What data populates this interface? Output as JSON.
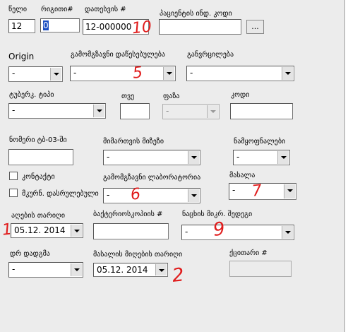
{
  "labels": {
    "year": "წელი",
    "row_no": "რიგითი#",
    "registry_no": "დათესვის #",
    "patient_code": "პაციენტის ინდ. კოდი",
    "origin": "Origin",
    "detected_institution": "გამომგზავნი დაწესებულება",
    "diagnosis": "განვრცილება",
    "tb_type": "ტუბერკ. ტიპი",
    "month": "თვე",
    "phase": "ფაზა",
    "code": "კოდი",
    "form_no": "ნომერი ტბ-03-ში",
    "referral_reason": "მიმართვის მიზეზი",
    "diagnosis_codes": "ნამყოფნალები",
    "contact": "კონტაქტი",
    "monitoring": "მკურნ. დასრულებული",
    "sending_laboratory": "გამომგზავნი ლაბორატორია",
    "material": "მასალა",
    "taken_date": "აღების თარიღი",
    "bacterio_no": "ბაქტერიოსკოპიის #",
    "smear_result": "ნაცხის მიკრ. შედეგი",
    "doctor": "დრ დადგმა",
    "material_received_date": "მასალის მიღების თარიღი",
    "culture_no": "ქცითარი #"
  },
  "fields": {
    "year": "12",
    "row_no": "0",
    "registry_no": "12-000000",
    "patient_code": "",
    "browse_button": "...",
    "origin": "-",
    "detected_institution": "-",
    "diagnosis": "-",
    "tb_type": "-",
    "month": "",
    "phase": "-",
    "code": "",
    "form_no": "",
    "referral_reason": "-",
    "diagnosis_codes": "-",
    "sending_laboratory": "-",
    "material": "-",
    "taken_date": "05.12. 2014",
    "bacterio_no": "",
    "smear_result": "-",
    "doctor": "-",
    "material_received_date": "05.12. 2014",
    "culture_no": ""
  },
  "annotations": {
    "a10": "10",
    "a5": "5",
    "a6": "6",
    "a7": "7",
    "a1": "1",
    "a9": "9",
    "a2": "2"
  },
  "colors": {
    "annotation": "#e01c1c",
    "panel": "#ececec",
    "selection": "#1b4fc2"
  }
}
